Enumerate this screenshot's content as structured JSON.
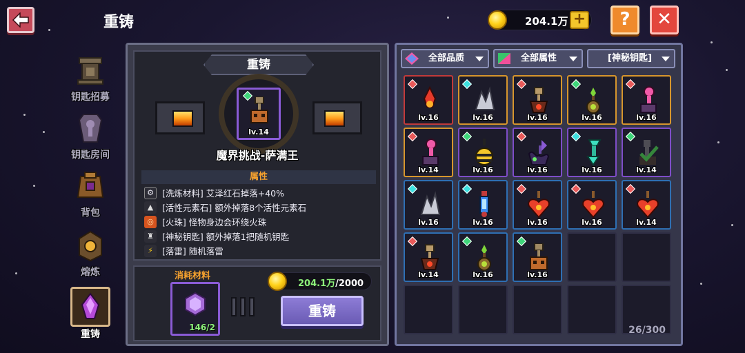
{
  "header": {
    "title": "重铸",
    "coin_amount": "204.1万",
    "plus_label": "+",
    "help_label": "?",
    "close_label": "✕"
  },
  "side_nav": [
    {
      "label": "钥匙招募",
      "icon": "key-recruit-icon",
      "active": false
    },
    {
      "label": "钥匙房间",
      "icon": "key-room-icon",
      "active": false
    },
    {
      "label": "背包",
      "icon": "backpack-icon",
      "active": false
    },
    {
      "label": "熔炼",
      "icon": "smelt-icon",
      "active": false
    },
    {
      "label": "重铸",
      "icon": "reforge-icon",
      "active": true
    }
  ],
  "forge": {
    "title": "重铸",
    "target_level": "lv.14",
    "target_gem_color": "#3fd67a",
    "item_name": "魔界挑战-萨满王",
    "attr_header": "属性",
    "attributes": [
      {
        "icon": "gear-icon",
        "text": "[洗炼材料] 艾泽红石掉落+40%"
      },
      {
        "icon": "crystal-pile-icon",
        "text": "[活性元素石] 额外掉落8个活性元素石"
      },
      {
        "icon": "fire-orb-icon",
        "text": "[火珠] 怪物身边会环绕火珠"
      },
      {
        "icon": "key-icon",
        "text": "[神秘钥匙] 额外掉落1把随机钥匙"
      },
      {
        "icon": "lightning-icon",
        "text": "[落雷] 随机落雷"
      }
    ]
  },
  "consume": {
    "label": "消耗材料",
    "material_count": "146/2",
    "cost_have": "204.1万",
    "cost_need": "/2000",
    "reforge_button": "重铸"
  },
  "filters": {
    "quality": "全部品质",
    "attribute": "全部属性",
    "key_type": "[神秘钥匙]"
  },
  "inventory": {
    "count": "26/300",
    "items": [
      {
        "lv": "lv.16",
        "rarity": "red",
        "gem": "#e85a5a",
        "art": "red-flame-key"
      },
      {
        "lv": "lv.16",
        "rarity": "orange",
        "gem": "#3ee0e0",
        "art": "silver-crystal-key"
      },
      {
        "lv": "lv.16",
        "rarity": "orange",
        "gem": "#e85a5a",
        "art": "bronze-key"
      },
      {
        "lv": "lv.16",
        "rarity": "orange",
        "gem": "#3fd67a",
        "art": "green-seed-key"
      },
      {
        "lv": "lv.16",
        "rarity": "orange",
        "gem": "#e85a5a",
        "art": "pink-key"
      },
      {
        "lv": "lv.14",
        "rarity": "orange",
        "gem": "#e85a5a",
        "art": "pink-key"
      },
      {
        "lv": "lv.16",
        "rarity": "purple",
        "gem": "#3fd67a",
        "art": "bee-key"
      },
      {
        "lv": "lv.16",
        "rarity": "purple",
        "gem": "#e85a5a",
        "art": "dark-purple-key"
      },
      {
        "lv": "lv.16",
        "rarity": "purple",
        "gem": "#3ee0e0",
        "art": "teal-key"
      },
      {
        "lv": "lv.14",
        "rarity": "purple",
        "gem": "#3fd67a",
        "art": "checked-key"
      },
      {
        "lv": "lv.16",
        "rarity": "blue",
        "gem": "#3ee0e0",
        "art": "silver-crystal-key"
      },
      {
        "lv": "lv.16",
        "rarity": "blue",
        "gem": "#3ee0e0",
        "art": "blue-potion-key"
      },
      {
        "lv": "lv.16",
        "rarity": "blue",
        "gem": "#e85a5a",
        "art": "heart-key"
      },
      {
        "lv": "lv.16",
        "rarity": "blue",
        "gem": "#e85a5a",
        "art": "heart-key"
      },
      {
        "lv": "lv.14",
        "rarity": "blue",
        "gem": "#e85a5a",
        "art": "heart-key"
      },
      {
        "lv": "lv.14",
        "rarity": "blue",
        "gem": "#e85a5a",
        "art": "bronze-key"
      },
      {
        "lv": "lv.16",
        "rarity": "blue",
        "gem": "#3fd67a",
        "art": "green-seed-key"
      },
      {
        "lv": "lv.16",
        "rarity": "blue",
        "gem": "#3fd67a",
        "art": "totem-key"
      }
    ]
  },
  "colors": {
    "rarity_red": "#c23a3a",
    "rarity_orange": "#d7962c",
    "rarity_purple": "#7e4dc8",
    "rarity_blue": "#2e6fb3",
    "accent_orange": "#f5a12e",
    "accent_green": "#8df27a"
  }
}
